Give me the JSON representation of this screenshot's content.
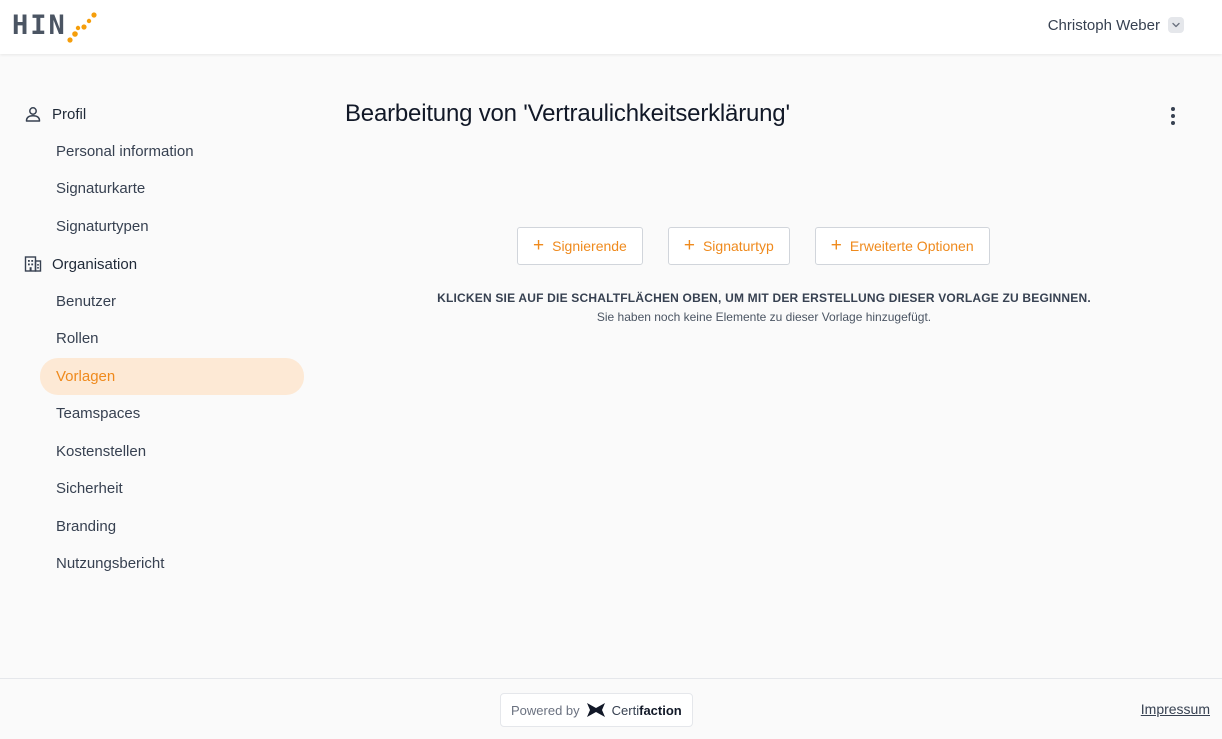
{
  "header": {
    "logo_text": "HIN",
    "user_name": "Christoph Weber"
  },
  "sidebar": {
    "sections": [
      {
        "title": "Profil",
        "icon": "user-icon",
        "items": [
          {
            "label": "Personal information"
          },
          {
            "label": "Signaturkarte"
          },
          {
            "label": "Signaturtypen"
          }
        ]
      },
      {
        "title": "Organisation",
        "icon": "building-icon",
        "items": [
          {
            "label": "Benutzer"
          },
          {
            "label": "Rollen"
          },
          {
            "label": "Vorlagen",
            "active": true
          },
          {
            "label": "Teamspaces"
          },
          {
            "label": "Kostenstellen"
          },
          {
            "label": "Sicherheit"
          },
          {
            "label": "Branding"
          },
          {
            "label": "Nutzungsbericht"
          }
        ]
      }
    ]
  },
  "main": {
    "title": "Bearbeitung von 'Vertraulichkeitserklärung'",
    "buttons": {
      "signers": "Signierende",
      "signature_type": "Signaturtyp",
      "advanced_options": "Erweiterte Optionen"
    },
    "empty_state": {
      "heading": "KLICKEN SIE AUF DIE SCHALTFLÄCHEN OBEN, UM MIT DER ERSTELLUNG DIESER VORLAGE ZU BEGINNEN.",
      "subtext": "Sie haben noch keine Elemente zu dieser Vorlage hinzugefügt."
    }
  },
  "footer": {
    "powered_by": "Powered by",
    "brand_prefix": "Certi",
    "brand_suffix": "faction",
    "impressum": "Impressum"
  },
  "colors": {
    "accent": "#ef8a1d",
    "active_bg": "#fde9d5",
    "logo_dots": "#f59e0b"
  }
}
